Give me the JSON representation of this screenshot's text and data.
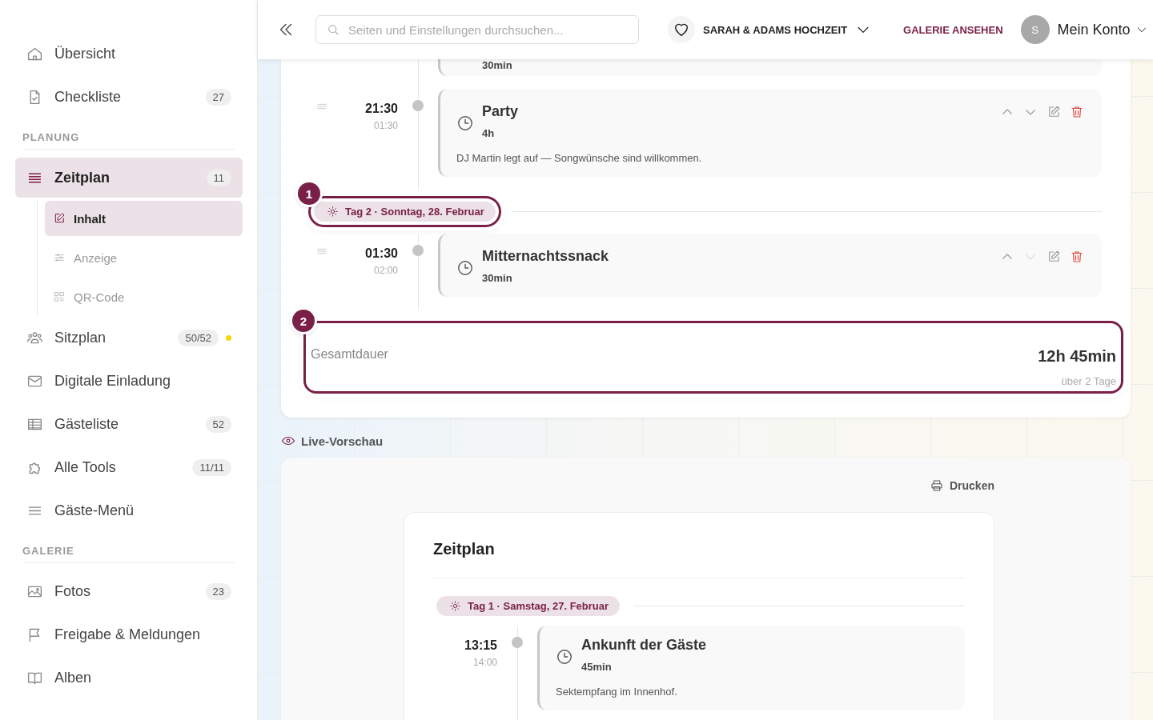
{
  "sidebar": {
    "groups": [
      {
        "items": [
          {
            "label": "Übersicht",
            "selected": false
          },
          {
            "label": "Checkliste",
            "count": "27",
            "selected": false
          }
        ]
      },
      {
        "heading": "PLANUNG",
        "items": [
          {
            "label": "Zeitplan",
            "count": "11",
            "selected": true,
            "children": [
              {
                "label": "Inhalt",
                "selected": true
              },
              {
                "label": "Anzeige",
                "selected": false
              },
              {
                "label": "QR-Code",
                "selected": false
              }
            ]
          },
          {
            "label": "Sitzplan",
            "count": "50/52",
            "color": "#f5d90a",
            "selected": false
          },
          {
            "label": "Digitale Einladung",
            "selected": false
          },
          {
            "label": "Gästeliste",
            "count": "52",
            "selected": false
          },
          {
            "label": "Alle Tools",
            "count": "11/11",
            "selected": false
          },
          {
            "label": "Gäste-Menü",
            "selected": false
          }
        ]
      },
      {
        "heading": "GALERIE",
        "items": [
          {
            "label": "Fotos",
            "count": "23",
            "selected": false
          },
          {
            "label": "Freigabe & Meldungen",
            "selected": false
          },
          {
            "label": "Alben",
            "selected": false
          }
        ]
      }
    ]
  },
  "header": {
    "search": {
      "placeholder": "Seiten und Einstellungen durchsuchen..."
    },
    "event": "SARAH & ADAMS HOCHZEIT",
    "gallery_link": "GALERIE ANSEHEN",
    "avatar": "S",
    "account": "Mein Konto"
  },
  "editor": {
    "rows": [
      {
        "kind": "cut",
        "duration": "30min"
      },
      {
        "kind": "event",
        "start": "21:30",
        "end": "01:30",
        "title": "Party",
        "duration": "4h",
        "note": "DJ Martin legt auf — Songwünsche sind willkommen.",
        "down_disabled": false
      },
      {
        "kind": "day",
        "label": "Tag 2 · Sonntag, 28. Februar",
        "callout": "1"
      },
      {
        "kind": "event",
        "start": "01:30",
        "end": "02:00",
        "title": "Mitternachtssnack",
        "duration": "30min",
        "down_disabled": true
      }
    ],
    "total": {
      "label": "Gesamtdauer",
      "value": "12h 45min",
      "sub": "über 2 Tage",
      "callout": "2"
    }
  },
  "preview": {
    "heading": "Live-Vorschau",
    "print": "Drucken",
    "title": "Zeitplan",
    "day": "Tag 1 · Samstag, 27. Februar",
    "events": [
      {
        "start": "13:15",
        "end": "14:00",
        "title": "Ankunft der Gäste",
        "duration": "45min",
        "note": "Sektempfang im Innenhof."
      }
    ]
  }
}
